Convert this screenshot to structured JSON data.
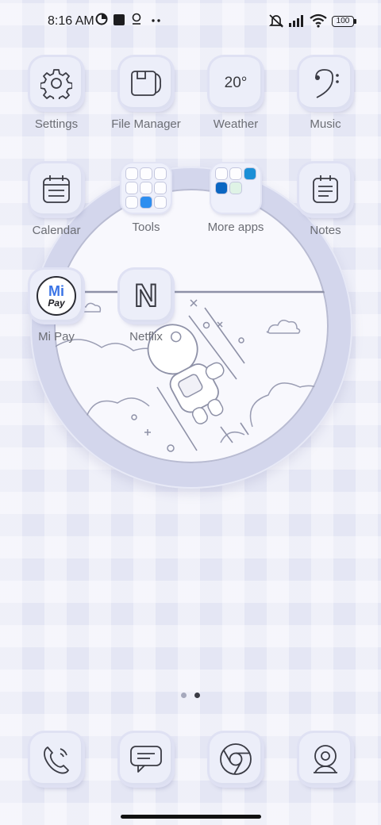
{
  "status_bar": {
    "time": "8:16 AM",
    "battery": "100",
    "icons": [
      "data-saver-icon",
      "square-notification-icon",
      "location-pin-icon",
      "more-dots-icon",
      "muted-bell-icon",
      "signal-icon",
      "wifi-icon",
      "battery-icon"
    ]
  },
  "apps": {
    "settings": "Settings",
    "file_manager": "File Manager",
    "weather": "Weather",
    "weather_temp": "20°",
    "music": "Music",
    "calendar": "Calendar",
    "tools": "Tools",
    "more_apps": "More apps",
    "notes": "Notes",
    "mipay": "Mi Pay",
    "mipay_mi": "Mi",
    "mipay_pay": "Pay",
    "netflix": "Netflix",
    "netflix_letter": "N"
  },
  "page_indicator": {
    "pages": 2,
    "current": 2
  },
  "dock": [
    "phone-icon",
    "messages-icon",
    "chrome-icon",
    "camera-icon"
  ],
  "colors": {
    "background": "#e4e6f4",
    "tile": "#eceef9",
    "line": "#3a3b44",
    "mipay_blue": "#3a74e6",
    "label": "#6b6d74"
  }
}
